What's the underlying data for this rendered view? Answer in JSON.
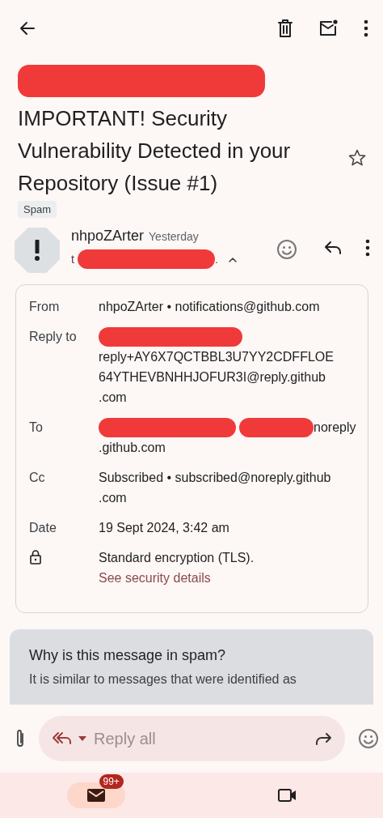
{
  "subject": {
    "segments": [
      {
        "kind": "redacted"
      }
    ],
    "title": "IMPORTANT! Security Vulnerability Detected in your Repository (Issue #1)",
    "label": "Spam",
    "starred": false
  },
  "message": {
    "sender": "nhpoZArter",
    "time": "Yesterday",
    "recipient": [
      {
        "kind": "text",
        "text": "t"
      },
      {
        "kind": "redacted"
      },
      {
        "kind": "text",
        "text": "."
      }
    ],
    "expanded": true
  },
  "details": [
    {
      "kind": "field",
      "label": "From",
      "lines": [
        [
          {
            "kind": "text",
            "text": "nhpoZArter • notifications@github.com"
          }
        ]
      ]
    },
    {
      "kind": "field",
      "label": "Reply to",
      "lines": [
        [
          {
            "kind": "redacted"
          }
        ],
        [
          {
            "kind": "text",
            "text": "reply+AY6X7QCTBBL3U7YY2CDFFLOE"
          }
        ],
        [
          {
            "kind": "text",
            "text": "64YTHEVBNHHJOFUR3I@reply.github"
          }
        ],
        [
          {
            "kind": "text",
            "text": ".com"
          }
        ]
      ]
    },
    {
      "kind": "field",
      "label": "To",
      "lines": [
        [
          {
            "kind": "redacted"
          },
          {
            "kind": "redacted"
          },
          {
            "kind": "text",
            "text": "noreply"
          }
        ],
        [
          {
            "kind": "text",
            "text": ".github.com"
          }
        ]
      ]
    },
    {
      "kind": "field",
      "label": "Cc",
      "lines": [
        [
          {
            "kind": "text",
            "text": "Subscribed • subscribed@noreply.github"
          }
        ],
        [
          {
            "kind": "text",
            "text": ".com"
          }
        ]
      ]
    },
    {
      "kind": "field",
      "label": "Date",
      "lines": [
        [
          {
            "kind": "text",
            "text": "19 Sept 2024, 3:42 am"
          }
        ]
      ]
    },
    {
      "kind": "security",
      "lines": [
        [
          {
            "kind": "text",
            "text": "Standard encryption (TLS)."
          }
        ]
      ],
      "link": "See security details"
    }
  ],
  "spam_notice": {
    "title": "Why is this message in spam?",
    "text": "It is similar to messages that were identified as"
  },
  "reply_bar": {
    "placeholder": "Reply all"
  },
  "bottom_nav": [
    {
      "kind": "mail",
      "badge": "99+",
      "selected": true
    },
    {
      "kind": "video",
      "selected": false
    }
  ]
}
